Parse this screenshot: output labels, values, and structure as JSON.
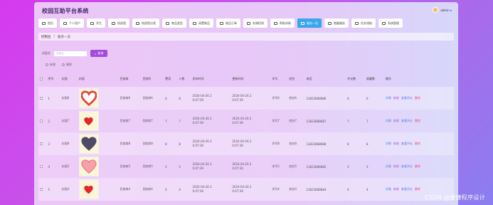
{
  "app": {
    "title": "校园互助平台系统"
  },
  "user": {
    "name": "admin ▾"
  },
  "nav": [
    {
      "label": "首页",
      "icon": "home-icon",
      "active": false
    },
    {
      "label": "个人用户",
      "icon": "user-icon",
      "active": false
    },
    {
      "label": "学生",
      "icon": "student-icon",
      "active": false
    },
    {
      "label": "校园墙",
      "icon": "grid-icon",
      "active": false
    },
    {
      "label": "校园墙分类",
      "icon": "list-icon",
      "active": false
    },
    {
      "label": "物品类型",
      "icon": "list-icon",
      "active": false
    },
    {
      "label": "闲置物品",
      "icon": "box-icon",
      "active": false
    },
    {
      "label": "物品订单",
      "icon": "order-icon",
      "active": false
    },
    {
      "label": "失物招领",
      "icon": "grid-icon",
      "active": false
    },
    {
      "label": "帮助求助",
      "icon": "help-icon",
      "active": false
    },
    {
      "label": "服务一览",
      "icon": "service-icon",
      "active": true
    },
    {
      "label": "跑腿服务",
      "icon": "run-icon",
      "active": false
    },
    {
      "label": "任务领取",
      "icon": "task-icon",
      "active": false
    },
    {
      "label": "系统管理",
      "icon": "gear-icon",
      "active": false
    }
  ],
  "breadcrumb": {
    "home": "控制台",
    "sep": "/",
    "current": "服务一览"
  },
  "search": {
    "label": "封面名",
    "placeholder": "封面名",
    "button": "查询"
  },
  "actions": {
    "add": "新增",
    "delete": "删除"
  },
  "table": {
    "headers": [
      "",
      "序号",
      "封面",
      "封面",
      "目前商",
      "目前的",
      "费用",
      "人数",
      "发布时间",
      "更新时间",
      "学号",
      "姓名",
      "电话",
      "评论数",
      "收藏数",
      "操作"
    ],
    "rows": [
      {
        "no": "1",
        "name": "封面6",
        "pic": "heart-outline",
        "f1": "目前商6",
        "f2": "目前商6",
        "fee": "6",
        "count": "6",
        "pub": "2024-04-26 2\n0:07:39",
        "upd": "2024-04-26 2\n0:07:39",
        "sid": "学号6",
        "sname": "姓名6",
        "phone": "13823888886",
        "c": "6",
        "fav": "6"
      },
      {
        "no": "2",
        "name": "封面7",
        "pic": "heart-red",
        "f1": "目前商7",
        "f2": "目前商7",
        "fee": "7",
        "count": "7",
        "pub": "2024-04-26 2\n0:07:39",
        "upd": "2024-04-26 2\n0:07:39",
        "sid": "学号7",
        "sname": "姓名7",
        "phone": "13823888887",
        "c": "7",
        "fav": "7"
      },
      {
        "no": "3",
        "name": "封面8",
        "pic": "heart-dark",
        "f1": "目前商8",
        "f2": "目前商8",
        "fee": "8",
        "count": "8",
        "pub": "2024-04-26 2\n0:07:39",
        "upd": "2024-04-26 2\n0:07:39",
        "sid": "学号8",
        "sname": "姓名8",
        "phone": "13823888888",
        "c": "8",
        "fav": "8"
      },
      {
        "no": "4",
        "name": "封面5",
        "pic": "heart-pink",
        "f1": "目前商5",
        "f2": "目前商5",
        "fee": "5",
        "count": "5",
        "pub": "2024-04-26 2\n0:07:39",
        "upd": "2024-04-26 2\n0:07:39",
        "sid": "学号5",
        "sname": "姓名5",
        "phone": "13823888885",
        "c": "5",
        "fav": "5"
      },
      {
        "no": "5",
        "name": "封面4",
        "pic": "heart-red",
        "f1": "目前商4",
        "f2": "目前商4",
        "fee": "4",
        "count": "4",
        "pub": "2024-04-26 2\n0:07:39",
        "upd": "2024-04-26 2\n0:07:39",
        "sid": "学号4",
        "sname": "姓名4",
        "phone": "13823888884",
        "c": "4",
        "fav": "4"
      }
    ],
    "ops": [
      "详情",
      "修改",
      "查看评论",
      "删除"
    ]
  },
  "watermark": "CSDN @便捷程序设计"
}
